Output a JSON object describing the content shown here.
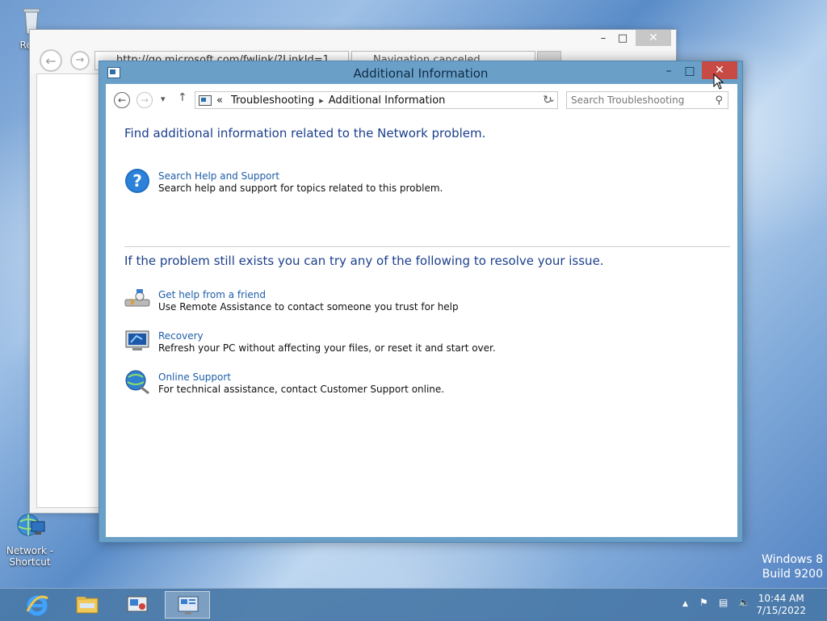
{
  "desktop": {
    "icons": [
      {
        "label": "Recy"
      },
      {
        "label_line1": "Network -",
        "label_line2": "Shortcut"
      }
    ],
    "watermark": {
      "line1": "Windows 8",
      "line2": "Build 9200"
    }
  },
  "background_window": {
    "address_text": "http://go.microsoft.com/fwlink/?LinkId=1",
    "tab_text": "Navigation canceled"
  },
  "window": {
    "title": "Additional Information",
    "breadcrumb": {
      "prefix": "«",
      "items": [
        "Troubleshooting",
        "Additional Information"
      ]
    },
    "search_placeholder": "Search Troubleshooting"
  },
  "content": {
    "heading1": "Find additional information related to the Network problem.",
    "help_item": {
      "link": "Search Help and Support",
      "desc": "Search help and support for topics related to this problem."
    },
    "heading2": "If the problem still exists you can try any of the following to resolve your issue.",
    "options": [
      {
        "link": "Get help from a friend",
        "desc": "Use Remote Assistance to contact someone you trust for help",
        "icon": "remote-assistance-icon"
      },
      {
        "link": "Recovery",
        "desc": "Refresh your PC without affecting your files, or reset it and start over.",
        "icon": "recovery-icon"
      },
      {
        "link": "Online Support",
        "desc": "For technical assistance, contact Customer Support online.",
        "icon": "online-support-icon"
      }
    ]
  },
  "taskbar": {
    "time": "10:44 AM",
    "date": "7/15/2022"
  },
  "colors": {
    "accent": "#6aa0c8",
    "close": "#c74a45",
    "heading": "#1b3f8c",
    "link": "#1e5ea8"
  }
}
